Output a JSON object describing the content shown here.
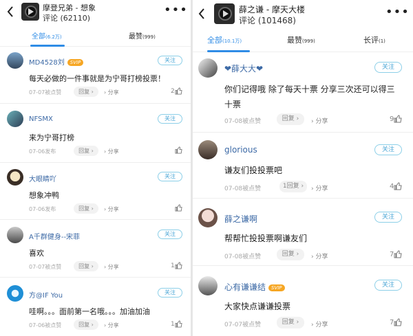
{
  "left": {
    "song_title": "摩登兄弟 - 想象",
    "comment_count": "评论 (62110)",
    "tabs": [
      {
        "label": "全部",
        "count": "(6.2万)"
      },
      {
        "label": "最赞",
        "count": "(999)"
      }
    ],
    "comments": [
      {
        "user": "MD4528刘",
        "svip": "SVIP",
        "text": "每天必做的一件事就是为宁哥打榜投票！",
        "date": "07-07被点赞",
        "reply": "回复",
        "share": "分享",
        "likes": "2",
        "follow": "关注"
      },
      {
        "user": "NFSMX",
        "text": "来为宁哥打榜",
        "date": "07-06发布",
        "reply": "回复",
        "share": "分享",
        "likes": "",
        "follow": "关注"
      },
      {
        "user": "大眼睛吖",
        "text": "想象冲鸭",
        "date": "07-06发布",
        "reply": "回复",
        "share": "分享",
        "likes": "",
        "follow": "关注"
      },
      {
        "user": "A千群健身--宋菲",
        "text": "喜欢",
        "date": "07-07被点赞",
        "reply": "回复",
        "share": "分享",
        "likes": "1",
        "follow": "关注"
      },
      {
        "user": "方@IF You",
        "text": "哇啊。。。面前第一名哦。。。加油加油",
        "date": "07-06被点赞",
        "reply": "回复",
        "share": "分享",
        "likes": "1",
        "follow": "关注"
      }
    ]
  },
  "right": {
    "song_title": "薛之谦 - 摩天大楼",
    "comment_count": "评论 (101468)",
    "tabs": [
      {
        "label": "全部",
        "count": "(10.1万)"
      },
      {
        "label": "最赞",
        "count": "(999)"
      },
      {
        "label": "长评",
        "count": "(1)"
      }
    ],
    "comments": [
      {
        "user": "❤薛大大❤",
        "text": "你们记得哦 除了每天十票 分享三次还可以得三十票",
        "date": "07-08被点赞",
        "reply": "回复",
        "share": "分享",
        "likes": "9",
        "follow": "关注"
      },
      {
        "user": "glorious",
        "text": "谦友们投投票吧",
        "date": "07-08被点赞",
        "reply": "1回复",
        "share": "分享",
        "likes": "4",
        "follow": "关注"
      },
      {
        "user": "薛之谦啊",
        "text": "帮帮忙投投票啊谦友们",
        "date": "07-08被点赞",
        "reply": "回复",
        "share": "分享",
        "likes": "7",
        "follow": "关注"
      },
      {
        "user": "心有谦谦结",
        "svip": "SVIP",
        "text": "大家快点谦谦投票",
        "date": "07-07被点赞",
        "reply": "回复",
        "share": "分享",
        "likes": "7",
        "follow": "关注"
      }
    ]
  },
  "colors": {
    "accent": "#2f8ce6",
    "username": "#3d6aa6",
    "follow_border": "#8ccfe8"
  }
}
